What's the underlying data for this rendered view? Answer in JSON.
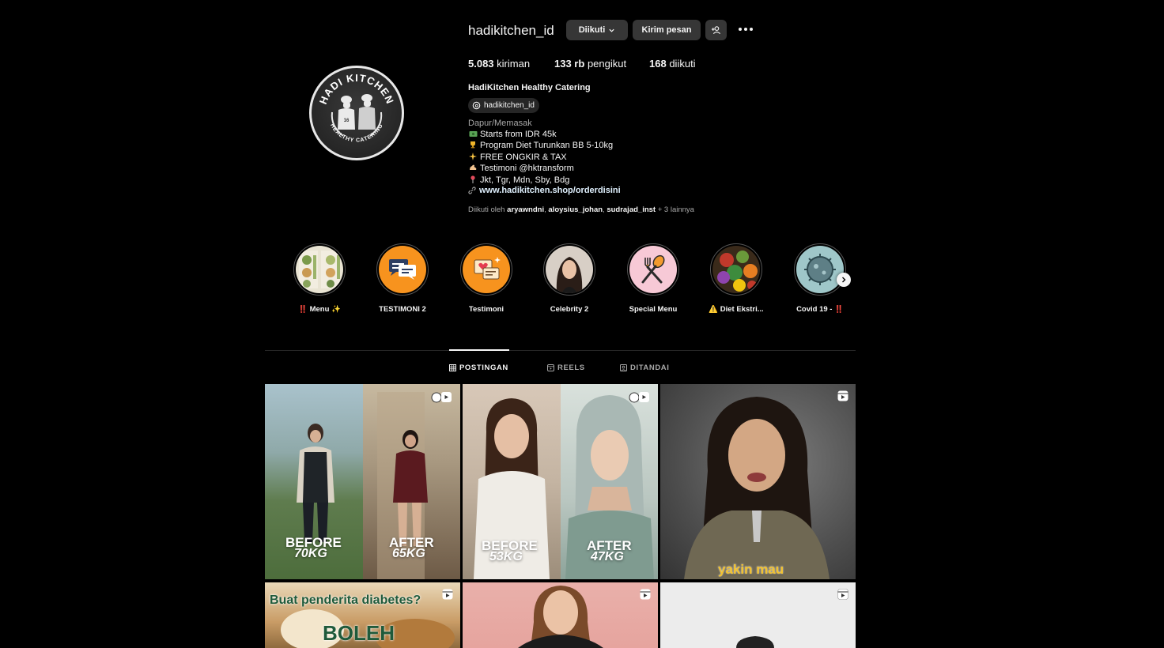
{
  "profile": {
    "username": "hadikitchen_id",
    "follow_label": "Diikuti",
    "message_label": "Kirim pesan",
    "stats": {
      "posts_count": "5.083",
      "posts_label": "kiriman",
      "followers_count": "133 rb",
      "followers_label": "pengikut",
      "following_count": "168",
      "following_label": "diikuti"
    },
    "full_name": "HadiKitchen Healthy Catering",
    "threads_handle": "hadikitchen_id",
    "category": "Dapur/Memasak",
    "bio": [
      {
        "icon": "money-icon",
        "text": "Starts from IDR 45k"
      },
      {
        "icon": "trophy-icon",
        "text": "Program Diet Turunkan BB 5-10kg"
      },
      {
        "icon": "sparkle-icon",
        "text": "FREE ONGKIR & TAX"
      },
      {
        "icon": "muscle-icon",
        "text": "Testimoni @hktransform"
      },
      {
        "icon": "pin-icon",
        "text": "Jkt, Tgr, Mdn, Sby, Bdg"
      }
    ],
    "link": "www.hadikitchen.shop/orderdisini",
    "followed_by": {
      "prefix": "Diikuti oleh",
      "user1": "aryawndni",
      "user2": "aloysius_johan",
      "user3": "sudrajad_inst",
      "suffix": "+ 3 lainnya"
    },
    "logo_text_top": "HADI KITCHEN",
    "logo_text_bottom": "HEALTHY CATERING"
  },
  "highlights": [
    {
      "label": "‼️ Menu ✨"
    },
    {
      "label": "TESTIMONI 2"
    },
    {
      "label": "Testimoni"
    },
    {
      "label": "Celebrity 2"
    },
    {
      "label": "Special Menu"
    },
    {
      "label": "⚠️ Diet Ekstri..."
    },
    {
      "label": "Covid 19 - ‼️"
    }
  ],
  "tabs": [
    {
      "label": "POSTINGAN",
      "icon": "grid-icon",
      "active": true
    },
    {
      "label": "REELS",
      "icon": "reels-icon",
      "active": false
    },
    {
      "label": "DITANDAI",
      "icon": "tagged-icon",
      "active": false
    }
  ],
  "posts": [
    {
      "before": "BEFORE",
      "before_weight": "70KG",
      "after": "AFTER",
      "after_weight": "65KG"
    },
    {
      "before": "BEFORE",
      "before_weight": "53KG",
      "after": "AFTER",
      "after_weight": "47KG"
    },
    {
      "caption": "yakin mau"
    },
    {
      "caption_top": "Buat penderita diabetes?",
      "caption_big": "BOLEH"
    },
    {},
    {}
  ],
  "colors": {
    "background": "#000000",
    "button": "#363636",
    "muted_text": "#a8a8a8",
    "link_text": "#e0f1ff",
    "caption_yellow": "#f2c230",
    "caption_green": "#1f5a3a"
  }
}
